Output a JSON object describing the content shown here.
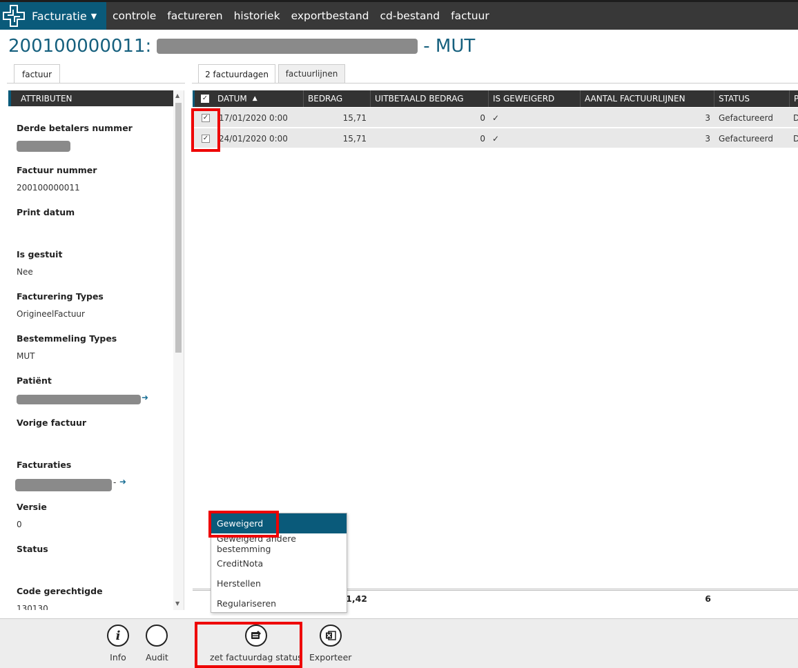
{
  "app": {
    "title": "Facturatie",
    "nav": [
      "controle",
      "factureren",
      "historiek",
      "exportbestand",
      "cd-bestand",
      "factuur"
    ]
  },
  "page": {
    "title_prefix": "200100000011:",
    "title_suffix": "- MUT"
  },
  "left_tabs": [
    {
      "label": "factuur"
    }
  ],
  "right_tabs": [
    {
      "label": "2 factuurdagen"
    },
    {
      "label": "factuurlijnen"
    }
  ],
  "attributes": {
    "header": "ATTRIBUTEN",
    "items": [
      {
        "label": "Derde betalers nummer",
        "value": ""
      },
      {
        "label": "Factuur nummer",
        "value": "200100000011"
      },
      {
        "label": "Print datum",
        "value": ""
      },
      {
        "label": "Is gestuit",
        "value": "Nee"
      },
      {
        "label": "Facturering Types",
        "value": "OrigineelFactuur"
      },
      {
        "label": "Bestemmeling Types",
        "value": "MUT"
      },
      {
        "label": "Patiënt",
        "value": ""
      },
      {
        "label": "Vorige factuur",
        "value": ""
      },
      {
        "label": "Facturaties",
        "value": "-"
      },
      {
        "label": "Versie",
        "value": "0"
      },
      {
        "label": "Status",
        "value": ""
      },
      {
        "label": "Code gerechtigde",
        "value": "130130"
      }
    ]
  },
  "grid": {
    "columns": [
      "DATUM",
      "BEDRAG",
      "UITBETAALD BEDRAG",
      "IS GEWEIGERD",
      "AANTAL FACTUURLIJNEN",
      "STATUS",
      "P"
    ],
    "rows": [
      {
        "datum": "17/01/2020 0:00",
        "bedrag": "15,71",
        "uitbetaald": "0",
        "geweigerd": "✓",
        "aantal": "3",
        "status": "Gefactureerd",
        "p": "D"
      },
      {
        "datum": "24/01/2020 0:00",
        "bedrag": "15,71",
        "uitbetaald": "0",
        "geweigerd": "✓",
        "aantal": "3",
        "status": "Gefactureerd",
        "p": "D"
      }
    ],
    "totals": {
      "bedrag": "31,42",
      "aantal": "6"
    }
  },
  "dropdown": {
    "items": [
      "Geweigerd",
      "Geweigerd andere bestemming",
      "CreditNota",
      "Herstellen",
      "Regulariseren"
    ]
  },
  "toolbar": {
    "info": "Info",
    "audit": "Audit",
    "status": "zet factuurdag status",
    "export": "Exporteer"
  },
  "colors": {
    "brand": "#0a5a7a",
    "title": "#16607e",
    "highlight": "#ee0000"
  }
}
